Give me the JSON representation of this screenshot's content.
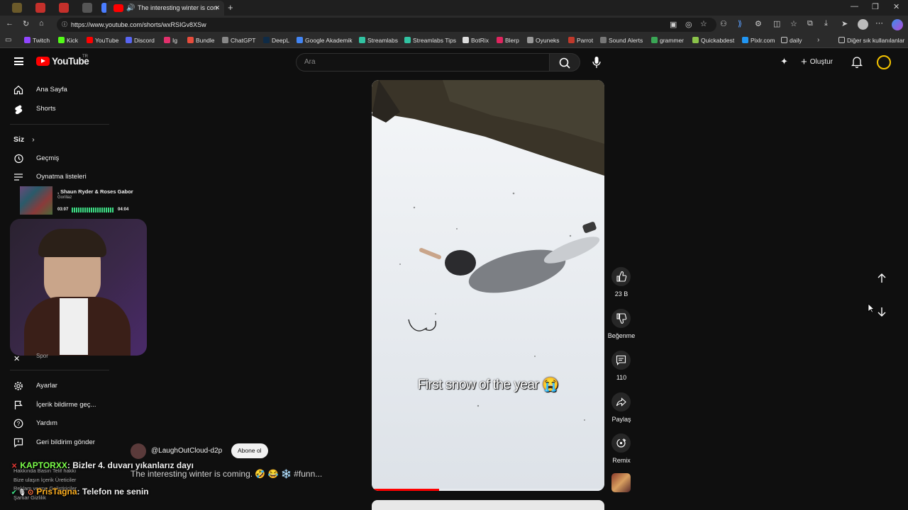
{
  "browser": {
    "active_tab_title": "The interesting winter is con",
    "url": "https://www.youtube.com/shorts/wxRSIGv8XSw",
    "bookmarks": [
      "Twitch",
      "Kick",
      "YouTube",
      "Discord",
      "Ig",
      "Bundle",
      "ChatGPT",
      "DeepL",
      "Google Akademik",
      "Streamlabs",
      "Streamlabs Tips",
      "BotRix",
      "Blerp",
      "Oyuneks",
      "Parrot",
      "Sound Alerts",
      "grammer",
      "Quickabdest",
      "Pixlr.com",
      "daily"
    ],
    "other_bookmarks": "Diğer sık kullanılanlar"
  },
  "header": {
    "logo_text": "YouTube",
    "country_code": "TR",
    "search_placeholder": "Ara",
    "create_label": "Oluştur"
  },
  "sidebar": {
    "home": "Ana Sayfa",
    "shorts": "Shorts",
    "you": "Siz",
    "history": "Geçmiş",
    "playlists": "Oynatma listeleri",
    "sports": "Spor",
    "settings": "Ayarlar",
    "report_history": "İçerik bildirme geç...",
    "help": "Yardım",
    "feedback": "Geri bildirim gönder",
    "footer_row1": "Hakkında  Basın  Telif hakkı",
    "footer_row2": "Bize ulaşın  İçerik Üreticiler",
    "footer_row3": "Reklam verme  Geliştiriciler",
    "footer_row4": "Şartlar  Gizlilik"
  },
  "now_playing": {
    "title": ", Shaun Ryder & Roses Gabor",
    "artist": "Gorillaz",
    "elapsed": "03:07",
    "total": "04:04"
  },
  "video": {
    "caption": "First snow of the year 😭",
    "channel": "@LaughOutCloud-d2p",
    "subscribe_label": "Abone ol",
    "description": "The interesting winter is coming. 🤣 😂 ❄️ #funn...",
    "progress_fraction": 0.29
  },
  "actions": {
    "likes": "23 B",
    "dislike_label": "Beğenme",
    "comments": "110",
    "share_label": "Paylaş",
    "remix_label": "Remix"
  },
  "chat": [
    {
      "user": "KAPTORXX",
      "message": ": Bizler 4. duvarı yıkanlarız dayı",
      "color": "#7cff4a"
    },
    {
      "user": "PrisTagna",
      "message": ": Telefon ne senin",
      "color": "#ffb020"
    }
  ],
  "colors": {
    "youtube_red": "#ff0000",
    "background": "#0f0f0f",
    "accent_yellow": "#f5c400"
  }
}
